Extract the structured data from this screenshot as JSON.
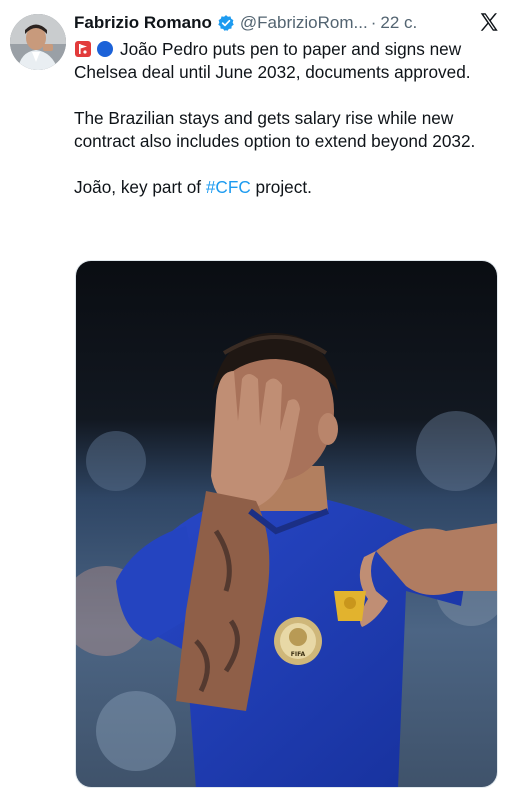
{
  "author": {
    "name": "Fabrizio Romano",
    "handle": "@FabrizioRom...",
    "separator": "·",
    "time": "22 с.",
    "verified": true,
    "avatar_icon": "avatar-photo"
  },
  "tweet": {
    "line1_text": "João Pedro puts pen to paper and signs new Chelsea deal until June 2032, documents approved.",
    "para2": "The Brazilian stays and gets salary rise while new contract also includes option to extend beyond 2032.",
    "para3_prefix": "João, key part of ",
    "hashtag": "#CFC",
    "para3_suffix": " project."
  },
  "media": {
    "badge_text": "FIFA",
    "badge_ring_text": "WORLD CHAMPIONS"
  },
  "colors": {
    "link": "#1d9bf0",
    "verified": "#1d9bf0",
    "kit_blue": "#1f3fb0",
    "secondary_text": "#536471"
  },
  "icons": [
    "verified-badge-icon",
    "x-logo-icon",
    "red-flag-emoji",
    "blue-circle-emoji"
  ]
}
